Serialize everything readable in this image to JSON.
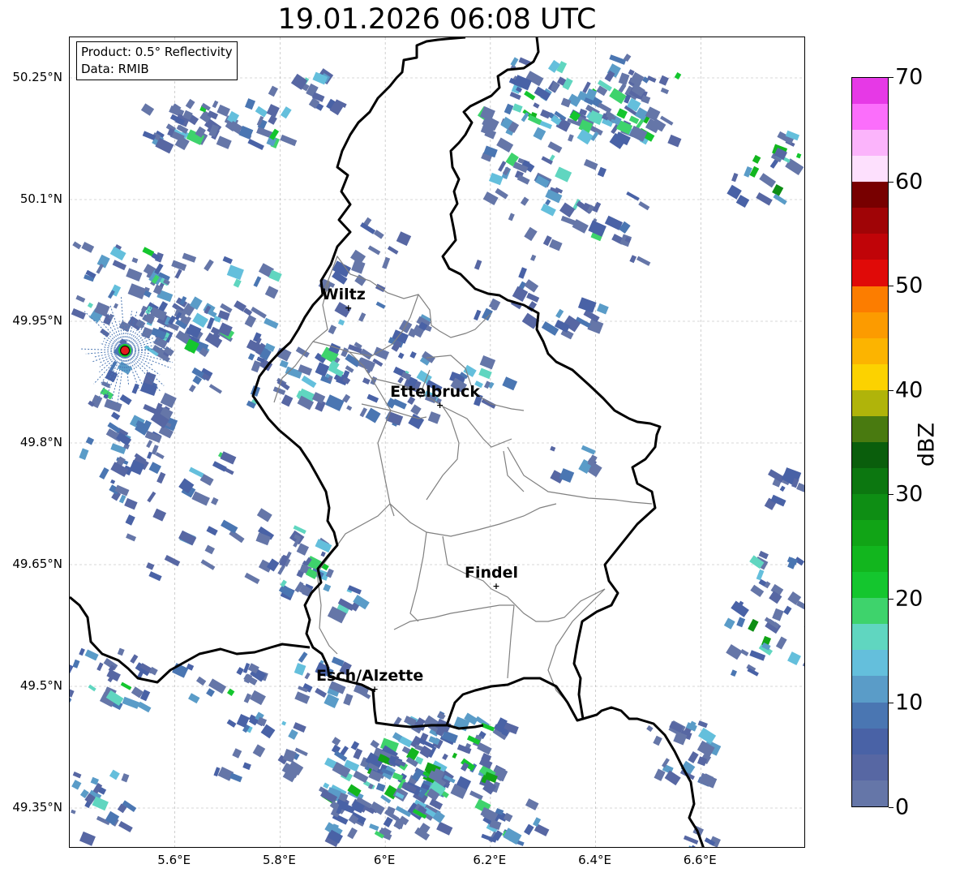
{
  "title": "19.01.2026 06:08 UTC",
  "info": {
    "product": "Product: 0.5° Reflectivity",
    "source": "Data: RMIB"
  },
  "map": {
    "extent_lon": [
      5.4,
      6.8
    ],
    "extent_lat": [
      49.3,
      50.3
    ],
    "lat_ticks": [
      {
        "value": 50.25,
        "label": "50.25°N"
      },
      {
        "value": 50.1,
        "label": "50.1°N"
      },
      {
        "value": 49.95,
        "label": "49.95°N"
      },
      {
        "value": 49.8,
        "label": "49.8°N"
      },
      {
        "value": 49.65,
        "label": "49.65°N"
      },
      {
        "value": 49.5,
        "label": "49.5°N"
      },
      {
        "value": 49.35,
        "label": "49.35°N"
      }
    ],
    "lon_ticks": [
      {
        "value": 5.6,
        "label": "5.6°E"
      },
      {
        "value": 5.8,
        "label": "5.8°E"
      },
      {
        "value": 6.0,
        "label": "6°E"
      },
      {
        "value": 6.2,
        "label": "6.2°E"
      },
      {
        "value": 6.4,
        "label": "6.4°E"
      },
      {
        "value": 6.6,
        "label": "6.6°E"
      }
    ],
    "cities": [
      {
        "name": "Wiltz",
        "lon": 5.93,
        "lat": 49.967
      },
      {
        "name": "Ettelbruck",
        "lon": 6.104,
        "lat": 49.847
      },
      {
        "name": "Findel",
        "lon": 6.211,
        "lat": 49.624
      },
      {
        "name": "Esch/Alzette",
        "lon": 5.98,
        "lat": 49.497
      }
    ],
    "radar_site": {
      "name": "radar-site",
      "lon": 5.505,
      "lat": 49.914
    },
    "colors": {
      "country_border": "#000000",
      "canton_border": "#808080",
      "grid": "#b0b0b0",
      "radar_marker": "#e41a1c"
    }
  },
  "colorbar": {
    "label": "dBZ",
    "min": 0,
    "max": 70,
    "ticks": [
      {
        "value": 0,
        "label": "0"
      },
      {
        "value": 10,
        "label": "10"
      },
      {
        "value": 20,
        "label": "20"
      },
      {
        "value": 30,
        "label": "30"
      },
      {
        "value": 40,
        "label": "40"
      },
      {
        "value": 50,
        "label": "50"
      },
      {
        "value": 60,
        "label": "60"
      },
      {
        "value": 70,
        "label": "70"
      }
    ],
    "colors": [
      "#6576a8",
      "#5767a3",
      "#4962a6",
      "#4a76b2",
      "#5a9cc8",
      "#64bfdc",
      "#60d6c0",
      "#3ed36c",
      "#14c62e",
      "#12b61e",
      "#11a416",
      "#0e8e14",
      "#0c7710",
      "#0a5e0c",
      "#497a10",
      "#b0b40a",
      "#fcd200",
      "#fcb400",
      "#fc9b00",
      "#fc7d00",
      "#e00a08",
      "#c00408",
      "#a00406",
      "#780000",
      "#fde0fd",
      "#fbb4fb",
      "#fb6efb",
      "#e639e6"
    ]
  }
}
